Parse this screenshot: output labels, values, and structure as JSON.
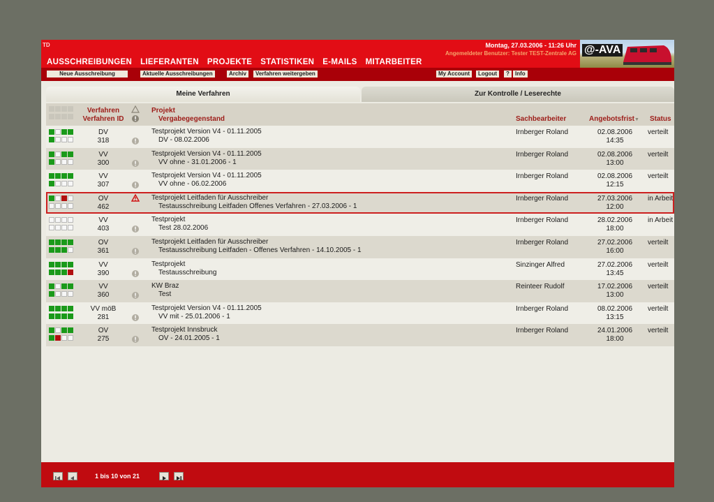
{
  "header": {
    "corner_text": "TD",
    "datetime": "Montag, 27.03.2006 - 11:26 Uhr",
    "user_line": "Angemeldeter Benutzer: Tester TEST-Zentrale AG",
    "logo": "@-AVA"
  },
  "main_nav": [
    "AUSSCHREIBUNGEN",
    "LIEFERANTEN",
    "PROJEKTE",
    "STATISTIKEN",
    "E-MAILS",
    "MITARBEITER"
  ],
  "toolbar": {
    "new_tender": "Neue Ausschreibung",
    "current": "Aktuelle Ausschreibungen",
    "archive": "Archiv",
    "forward": "Verfahren weitergeben",
    "account": "My Account",
    "logout": "Logout",
    "help": "?",
    "info": "Info"
  },
  "tabs": {
    "mine": "Meine Verfahren",
    "control": "Zur Kontrolle / Leserechte"
  },
  "columns": {
    "verfahren": "Verfahren",
    "verfahren_id": "Verfahren ID",
    "projekt": "Projekt",
    "vergabe": "Vergabegegenstand",
    "sachbearbeiter": "Sachbearbeiter",
    "angebotsfrist": "Angebotsfrist",
    "status": "Status"
  },
  "rows": [
    {
      "type": "DV",
      "id": "318",
      "project": "Testprojekt Version V4 - 01.11.2005",
      "subject": "DV - 08.02.2006",
      "clerk": "Irnberger Roland",
      "date": "02.08.2006",
      "time": "14:35",
      "status": "verteilt",
      "alert": "info",
      "grid": [
        "g",
        "e",
        "g",
        "g",
        "g",
        "e",
        "e",
        "e"
      ]
    },
    {
      "type": "VV",
      "id": "300",
      "project": "Testprojekt Version V4 - 01.11.2005",
      "subject": "VV ohne - 31.01.2006 - 1",
      "clerk": "Irnberger Roland",
      "date": "02.08.2006",
      "time": "13:00",
      "status": "verteilt",
      "alert": "info",
      "grid": [
        "g",
        "e",
        "g",
        "g",
        "g",
        "e",
        "e",
        "e"
      ]
    },
    {
      "type": "VV",
      "id": "307",
      "project": "Testprojekt Version V4 - 01.11.2005",
      "subject": "VV ohne - 06.02.2006",
      "clerk": "Irnberger Roland",
      "date": "02.08.2006",
      "time": "12:15",
      "status": "verteilt",
      "alert": "info",
      "grid": [
        "g",
        "g",
        "g",
        "g",
        "g",
        "e",
        "e",
        "e"
      ]
    },
    {
      "type": "OV",
      "id": "462",
      "project": "Testprojekt Leitfaden für Ausschreiber",
      "subject": "Testausschreibung Leitfaden Offenes Verfahren - 27.03.2006 - 1",
      "clerk": "Irnberger Roland",
      "date": "27.03.2006",
      "time": "12:00",
      "status": "in Arbeit",
      "alert": "warn",
      "selected": true,
      "grid": [
        "g",
        "e",
        "r",
        "e",
        "e",
        "e",
        "e",
        "e"
      ]
    },
    {
      "type": "VV",
      "id": "403",
      "project": "Testprojekt",
      "subject": "Test 28.02.2006",
      "clerk": "Irnberger Roland",
      "date": "28.02.2006",
      "time": "18:00",
      "status": "in Arbeit",
      "alert": "info",
      "grid": [
        "e",
        "e",
        "e",
        "e",
        "e",
        "e",
        "e",
        "e"
      ]
    },
    {
      "type": "OV",
      "id": "361",
      "project": "Testprojekt Leitfaden für Ausschreiber",
      "subject": "Testausschreibung Leitfaden - Offenes Verfahren - 14.10.2005 - 1",
      "clerk": "Irnberger Roland",
      "date": "27.02.2006",
      "time": "16:00",
      "status": "verteilt",
      "alert": "info",
      "grid": [
        "g",
        "g",
        "g",
        "g",
        "g",
        "g",
        "g",
        "e"
      ]
    },
    {
      "type": "VV",
      "id": "390",
      "project": "Testprojekt",
      "subject": "Testausschreibung",
      "clerk": "Sinzinger Alfred",
      "date": "27.02.2006",
      "time": "13:45",
      "status": "verteilt",
      "alert": "info",
      "grid": [
        "g",
        "g",
        "g",
        "g",
        "g",
        "g",
        "g",
        "r"
      ]
    },
    {
      "type": "VV",
      "id": "360",
      "project": "KW Braz",
      "subject": "Test",
      "clerk": "Reinteer Rudolf",
      "date": "17.02.2006",
      "time": "13:00",
      "status": "verteilt",
      "alert": "info",
      "grid": [
        "g",
        "e",
        "g",
        "g",
        "g",
        "e",
        "e",
        "e"
      ]
    },
    {
      "type": "VV möB",
      "id": "281",
      "project": "Testprojekt Version V4 - 01.11.2005",
      "subject": "VV mit - 25.01.2006 - 1",
      "clerk": "Irnberger Roland",
      "date": "08.02.2006",
      "time": "13:15",
      "status": "verteilt",
      "alert": "info",
      "grid": [
        "g",
        "g",
        "g",
        "g",
        "g",
        "g",
        "g",
        "g"
      ]
    },
    {
      "type": "OV",
      "id": "275",
      "project": "Testprojekt Innsbruck",
      "subject": "OV - 24.01.2005 - 1",
      "clerk": "Irnberger Roland",
      "date": "24.01.2006",
      "time": "18:00",
      "status": "verteilt",
      "alert": "info",
      "grid": [
        "g",
        "e",
        "g",
        "g",
        "g",
        "r",
        "e",
        "e"
      ]
    }
  ],
  "pagination": {
    "info": "1 bis 10 von 21"
  },
  "colors": {
    "brand_red": "#e20d15",
    "dark_red": "#a90008",
    "green": "#1a9a1a",
    "alert_red": "#b10f0f"
  }
}
